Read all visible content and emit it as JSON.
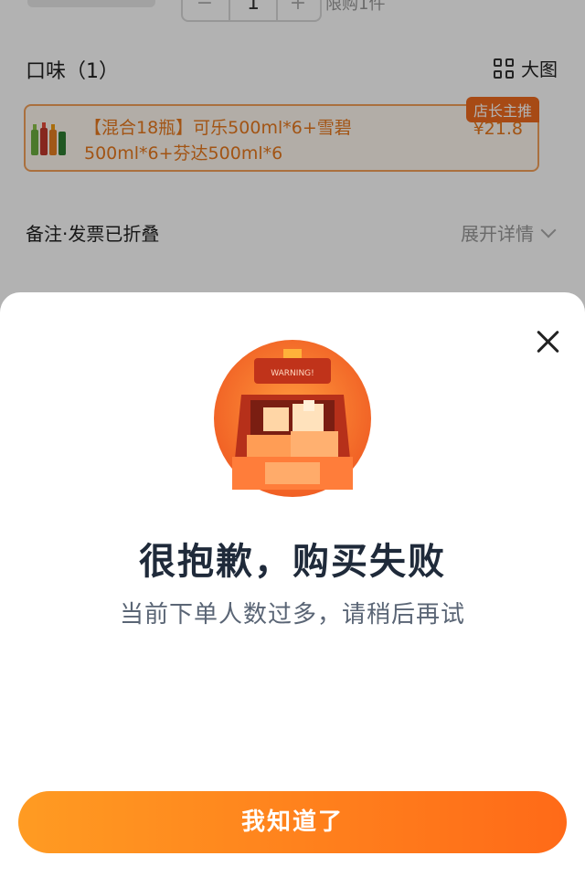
{
  "background": {
    "top": {
      "quantity": "1",
      "limit_text": "限购1件",
      "minus_symbol": "−",
      "plus_symbol": "+"
    },
    "flavor": {
      "title": "口味（1）",
      "big_view_label": "大图"
    },
    "product": {
      "name": "【混合18瓶】可乐500ml*6+雪碧500ml*6+芬达500ml*6",
      "badge": "店长主推",
      "price": "¥21.8"
    },
    "remark": {
      "label": "备注·发票已折叠",
      "expand_label": "展开详情"
    }
  },
  "dialog": {
    "title": "很抱歉，购买失败",
    "subtitle": "当前下单人数过多，请稍后再试",
    "confirm_label": "我知道了",
    "illustration_sign": "WARNING!"
  },
  "colors": {
    "accent": "#ff7a1a",
    "accent_gradient_start": "#ff9b22",
    "accent_gradient_end": "#ff6a18",
    "title_color": "#1f2a3a",
    "subtitle_color": "#5a6575"
  }
}
